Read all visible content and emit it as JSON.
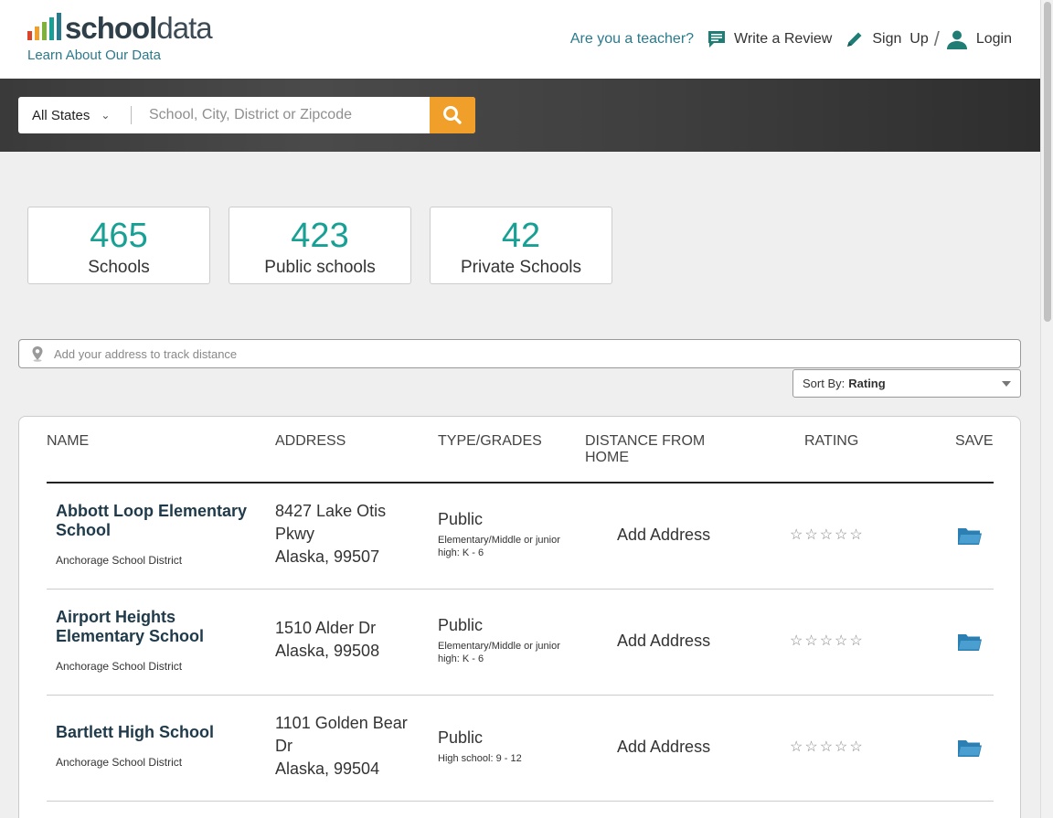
{
  "brand": {
    "logo_bold": "school",
    "logo_light": "data",
    "tagline": "Learn About Our Data",
    "bar_colors": [
      "#d9452b",
      "#f0a02a",
      "#7fb23a",
      "#18a094",
      "#2b7a8c"
    ]
  },
  "nav": {
    "teacher_link": "Are you a teacher?",
    "write_review": "Write a Review",
    "sign_up": "Sign  Up",
    "separator": "/",
    "login": "Login"
  },
  "search": {
    "state_value": "All States",
    "placeholder": "School, City, District or Zipcode"
  },
  "stats": [
    {
      "value": "465",
      "label": "Schools"
    },
    {
      "value": "423",
      "label": "Public schools"
    },
    {
      "value": "42",
      "label": "Private Schools"
    }
  ],
  "address_tracker": {
    "placeholder": "Add your address to track distance"
  },
  "sort": {
    "label": "Sort By:",
    "value": "Rating"
  },
  "table": {
    "headers": {
      "name": "NAME",
      "address": "ADDRESS",
      "type": "TYPE/GRADES",
      "distance_line1": "DISTANCE FROM",
      "distance_line2": "HOME",
      "rating": "RATING",
      "save": "SAVE"
    },
    "rows": [
      {
        "name": "Abbott Loop Elementary School",
        "district": "Anchorage School District",
        "address_line1": "8427 Lake Otis Pkwy",
        "address_line2": "Alaska, 99507",
        "type": "Public",
        "grades": "Elementary/Middle or junior high: K - 6",
        "distance": "Add Address",
        "stars": "☆☆☆☆☆"
      },
      {
        "name": "Airport Heights Elementary School",
        "district": "Anchorage School District",
        "address_line1": "1510 Alder Dr",
        "address_line2": "Alaska, 99508",
        "type": "Public",
        "grades": "Elementary/Middle or junior high: K - 6",
        "distance": "Add Address",
        "stars": "☆☆☆☆☆"
      },
      {
        "name": "Bartlett High School",
        "district": "Anchorage School District",
        "address_line1": "1101 Golden Bear Dr",
        "address_line2": "Alaska, 99504",
        "type": "Public",
        "grades": "High school: 9 - 12",
        "distance": "Add Address",
        "stars": "☆☆☆☆☆"
      }
    ]
  },
  "colors": {
    "accent_teal": "#18a094",
    "link_blue": "#2b7a8c",
    "search_orange": "#f0a02a",
    "folder_blue": "#2b7fb3"
  }
}
